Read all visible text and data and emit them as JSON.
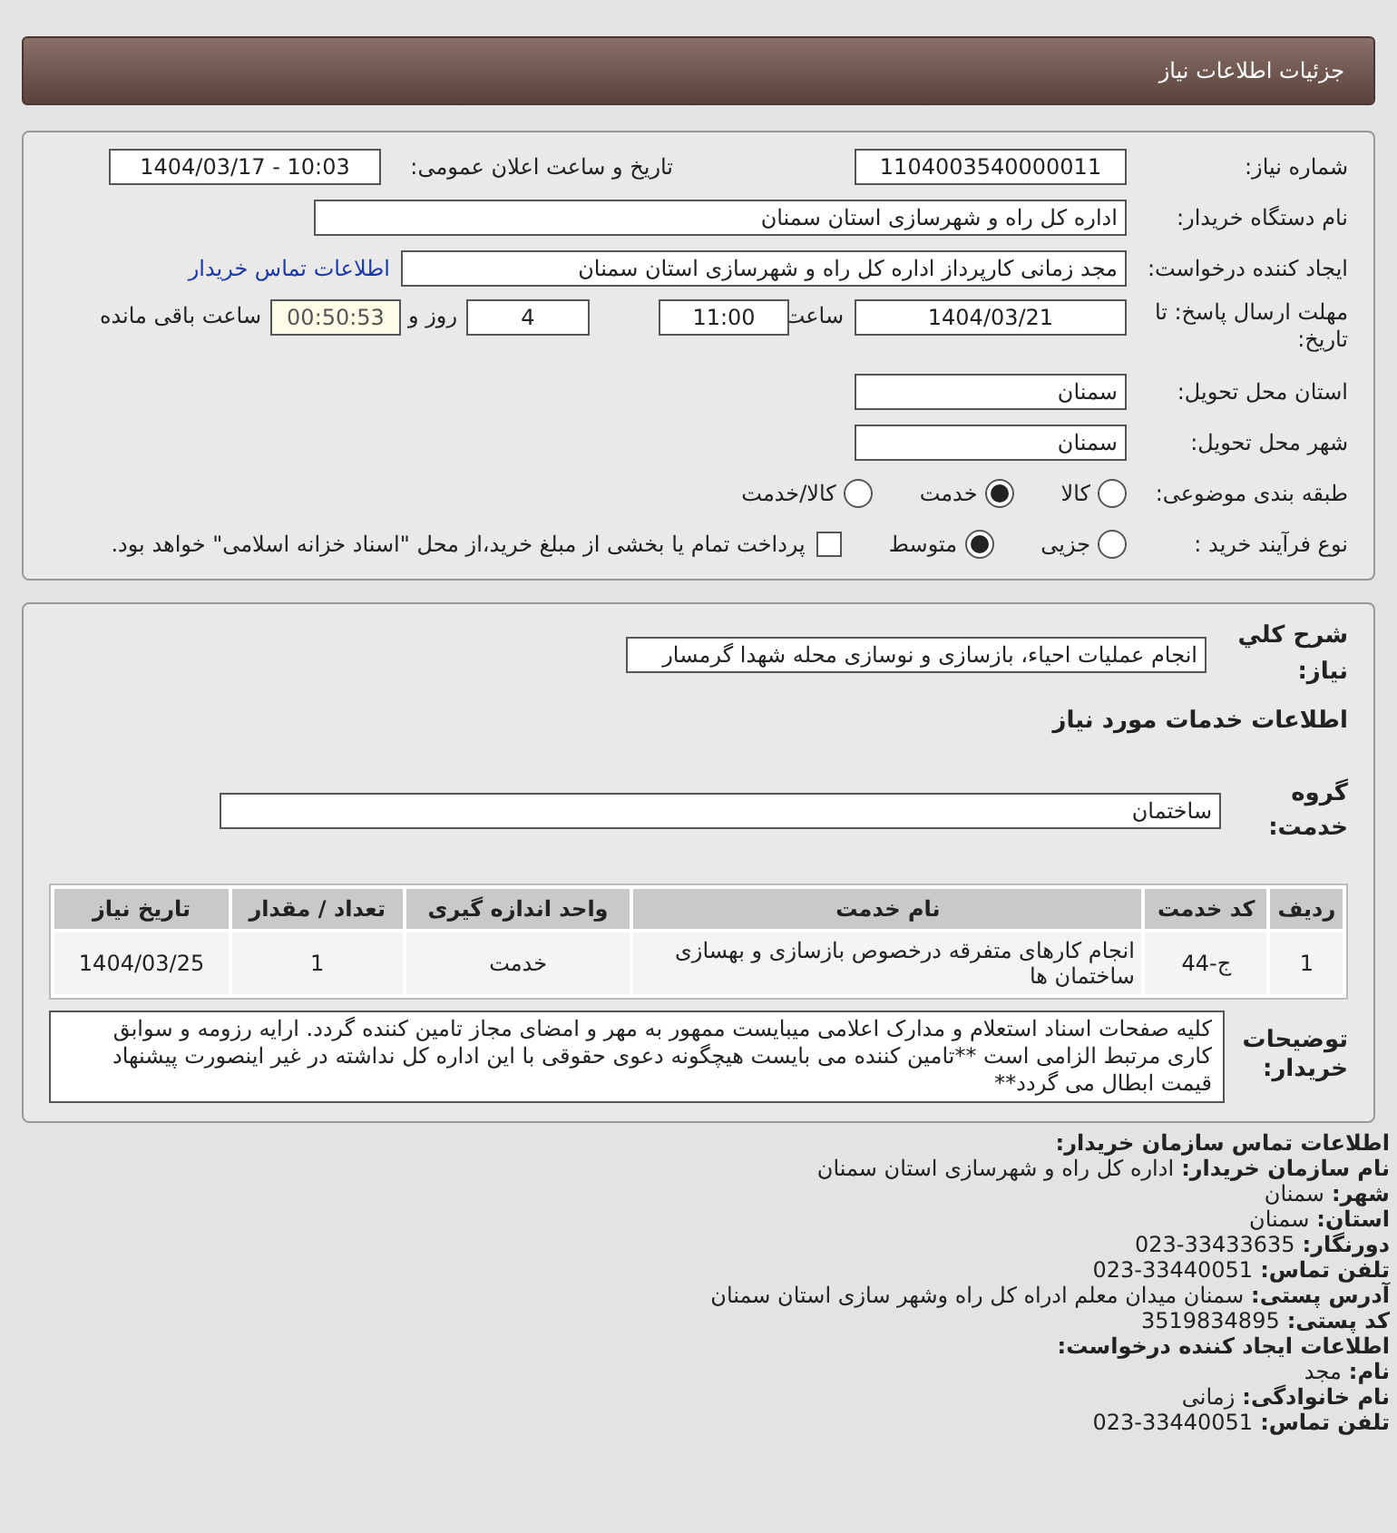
{
  "header": {
    "title": "جزئیات اطلاعات نیاز"
  },
  "need_number": {
    "label": "شماره نیاز:",
    "value": "1104003540000011"
  },
  "announce_date": {
    "label": "تاریخ و ساعت اعلان عمومی:",
    "value": "1404/03/17 - 10:03"
  },
  "buyer_org": {
    "label": "نام دستگاه خریدار:",
    "value": "اداره کل راه و شهرسازی استان سمنان"
  },
  "requester": {
    "label": "ایجاد کننده درخواست:",
    "value": "مجد زمانی کارپرداز اداره کل راه و شهرسازی استان سمنان",
    "link": "اطلاعات تماس خریدار"
  },
  "deadline": {
    "label": "مهلت ارسال پاسخ: تا تاریخ:",
    "date": "1404/03/21",
    "time_label": "ساعت",
    "time": "11:00",
    "days": "4",
    "days_label": "روز و",
    "remaining": "00:50:53",
    "remaining_label": "ساعت باقی مانده"
  },
  "province": {
    "label": "استان محل تحویل:",
    "value": "سمنان"
  },
  "city": {
    "label": "شهر محل تحویل:",
    "value": "سمنان"
  },
  "category": {
    "label": "طبقه بندی موضوعی:",
    "options": [
      {
        "label": "کالا",
        "selected": false
      },
      {
        "label": "خدمت",
        "selected": true
      },
      {
        "label": "کالا/خدمت",
        "selected": false
      }
    ]
  },
  "purchase_type": {
    "label": "نوع فرآیند خرید :",
    "options": [
      {
        "label": "جزیی",
        "selected": false
      },
      {
        "label": "متوسط",
        "selected": true
      }
    ],
    "payment": {
      "checked": false,
      "label": "پرداخت تمام یا بخشی از مبلغ خرید،از محل \"اسناد خزانه اسلامی\" خواهد بود."
    }
  },
  "summary": {
    "label": "شرح کلي نياز:",
    "value": "انجام عملیات احیاء، بازسازی و نوسازی محله شهدا گرمسار"
  },
  "services_title": "اطلاعات خدمات مورد نیاز",
  "service_group": {
    "label": "گروه خدمت:",
    "value": "ساختمان"
  },
  "table": {
    "columns": [
      "ردیف",
      "کد خدمت",
      "نام خدمت",
      "واحد اندازه گیری",
      "تعداد / مقدار",
      "تاریخ نیاز"
    ],
    "rows": [
      [
        "1",
        "ج-44",
        "انجام کارهای متفرقه درخصوص بازسازی و بهسازی ساختمان ها",
        "خدمت",
        "1",
        "1404/03/25"
      ]
    ]
  },
  "notes": {
    "label": "توضیحات خریدار:",
    "value": "کلیه صفحات اسناد استعلام و مدارک اعلامی میبایست ممهور به مهر و امضای مجاز تامین کننده گردد. ارایه رزومه و سوابق کاری مرتبط الزامی است **تامین کننده می بایست هیچگونه دعوی حقوقی با این اداره کل نداشته در غیر اینصورت پیشنهاد قیمت ابطال می گردد**"
  },
  "contact": [
    {
      "kind": "heading",
      "label": "اطلاعات تماس سازمان خریدار:"
    },
    {
      "kind": "field",
      "label": "نام سازمان خریدار:",
      "value": "اداره کل راه و شهرسازی استان سمنان"
    },
    {
      "kind": "field",
      "label": "شهر:",
      "value": "سمنان"
    },
    {
      "kind": "field",
      "label": "استان:",
      "value": "سمنان"
    },
    {
      "kind": "field",
      "label": "دورنگار:",
      "value": "023-33433635"
    },
    {
      "kind": "field",
      "label": "تلفن تماس:",
      "value": "023-33440051"
    },
    {
      "kind": "field",
      "label": "آدرس پستی:",
      "value": "سمنان میدان معلم ادراه کل راه وشهر سازی استان سمنان"
    },
    {
      "kind": "field",
      "label": "کد پستی:",
      "value": "3519834895"
    },
    {
      "kind": "heading",
      "label": "اطلاعات ایجاد کننده درخواست:"
    },
    {
      "kind": "field",
      "label": "نام:",
      "value": "مجد"
    },
    {
      "kind": "field",
      "label": "نام خانوادگی:",
      "value": "زمانی"
    },
    {
      "kind": "field",
      "label": "تلفن تماس:",
      "value": "023-33440051"
    }
  ]
}
